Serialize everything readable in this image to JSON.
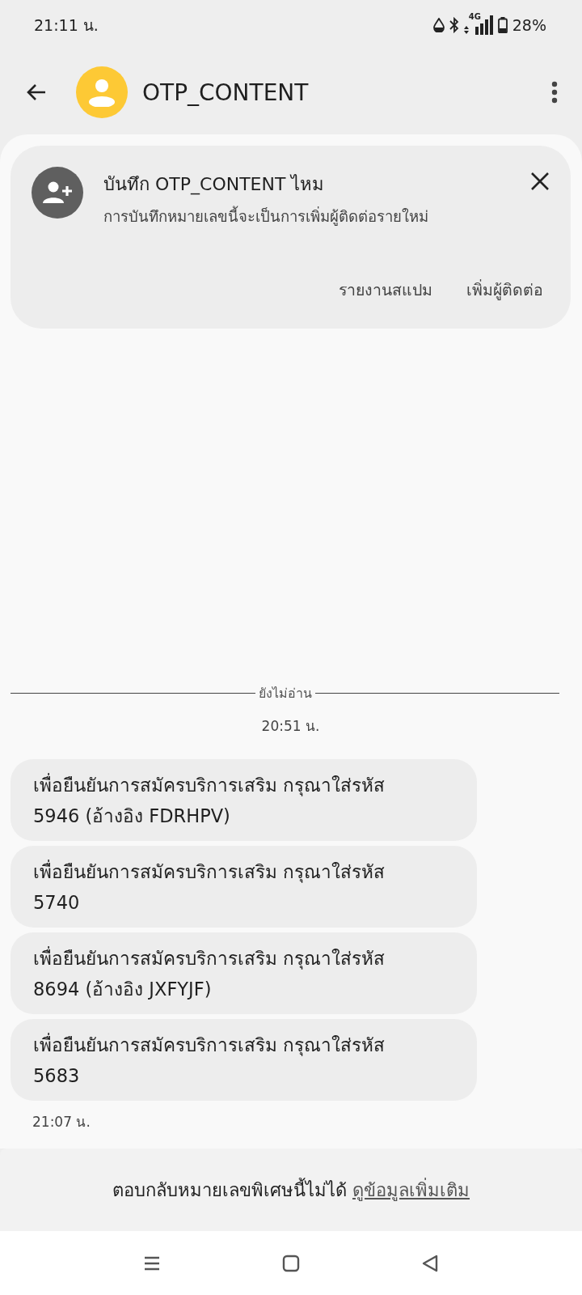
{
  "status_bar": {
    "time": "21:11 น.",
    "network": "4G",
    "battery": "28%"
  },
  "app_bar": {
    "title": "OTP_CONTENT"
  },
  "save_card": {
    "title": "บันทึก OTP_CONTENT ไหม",
    "subtitle": "การบันทึกหมายเลขนี้จะเป็นการเพิ่มผู้ติดต่อรายใหม่",
    "actions": [
      "รายงานสแปม",
      "เพิ่มผู้ติดต่อ"
    ]
  },
  "unread_divider": "ยังไม่อ่าน",
  "first_time": "20:51 น.",
  "messages": [
    {
      "text": "เพื่อยืนยันการสมัครบริการเสริม กรุณาใส่รหัส 5946 (อ้างอิง FDRHPV)"
    },
    {
      "text": "เพื่อยืนยันการสมัครบริการเสริม กรุณาใส่รหัส 5740"
    },
    {
      "text": "เพื่อยืนยันการสมัครบริการเสริม กรุณาใส่รหัส 8694 (อ้างอิง JXFYJF)"
    },
    {
      "text": "เพื่อยืนยันการสมัครบริการเสริม กรุณาใส่รหัส 5683"
    }
  ],
  "last_time": "21:07 น.",
  "footer": {
    "text": "ตอบกลับหมายเลขพิเศษนี้ไม่ได้",
    "link": "ดูข้อมูลเพิ่มเติม"
  }
}
